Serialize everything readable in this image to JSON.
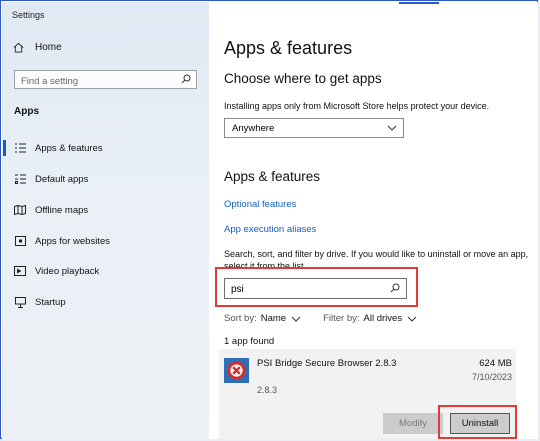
{
  "window": {
    "title": "Settings"
  },
  "sidebar": {
    "home_label": "Home",
    "search_placeholder": "Find a setting",
    "section": "Apps",
    "items": [
      {
        "label": "Apps & features",
        "icon": "list-icon",
        "active": true
      },
      {
        "label": "Default apps",
        "icon": "default-apps-icon"
      },
      {
        "label": "Offline maps",
        "icon": "map-icon"
      },
      {
        "label": "Apps for websites",
        "icon": "websites-icon"
      },
      {
        "label": "Video playback",
        "icon": "video-icon"
      },
      {
        "label": "Startup",
        "icon": "startup-icon"
      }
    ]
  },
  "main": {
    "title": "Apps & features",
    "choose_heading": "Choose where to get apps",
    "choose_desc": "Installing apps only from Microsoft Store helps protect your device.",
    "source_dropdown": "Anywhere",
    "section_heading": "Apps & features",
    "links": [
      "Optional features",
      "App execution aliases"
    ],
    "search_desc": "Search, sort, and filter by drive. If you would like to uninstall or move an app, select it from the list.",
    "search_value": "psi",
    "sort_label": "Sort by:",
    "sort_value": "Name",
    "filter_label": "Filter by:",
    "filter_value": "All drives",
    "count_text": "1 app found",
    "app": {
      "name": "PSI Bridge Secure Browser 2.8.3",
      "version": "2.8.3",
      "size": "624 MB",
      "date": "7/10/2023",
      "modify_label": "Modify",
      "uninstall_label": "Uninstall"
    }
  },
  "colors": {
    "accent": "#1a5fb4",
    "link": "#1560bd",
    "highlight": "#e53935"
  }
}
